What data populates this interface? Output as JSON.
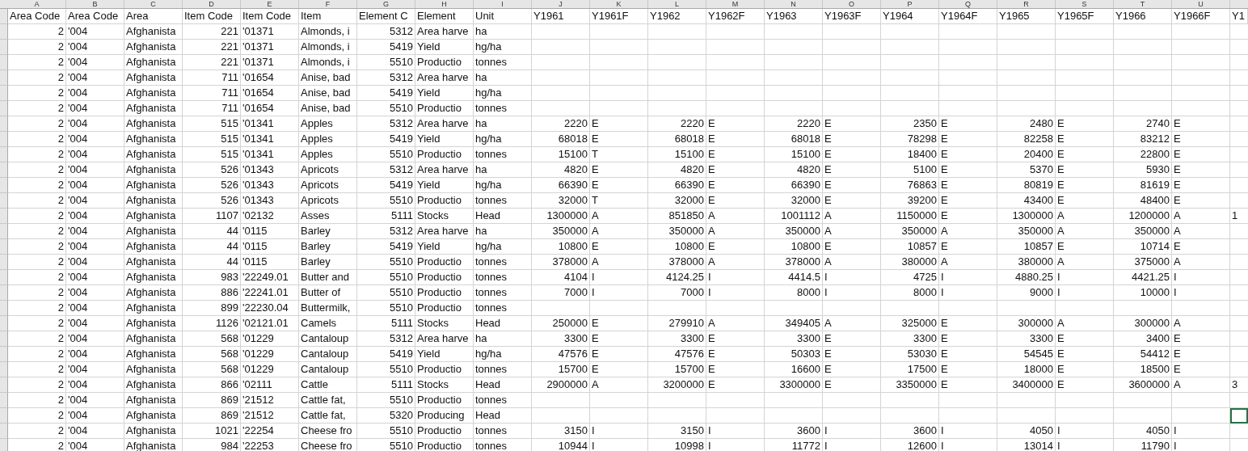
{
  "columns": [
    {
      "letter": "A",
      "heading": "Area Code",
      "kind": "number"
    },
    {
      "letter": "B",
      "heading": "Area Code",
      "kind": "text"
    },
    {
      "letter": "C",
      "heading": "Area",
      "kind": "text"
    },
    {
      "letter": "D",
      "heading": "Item Code",
      "kind": "number"
    },
    {
      "letter": "E",
      "heading": "Item Code",
      "kind": "text"
    },
    {
      "letter": "F",
      "heading": "Item",
      "kind": "text"
    },
    {
      "letter": "G",
      "heading": "Element C",
      "kind": "number"
    },
    {
      "letter": "H",
      "heading": "Element",
      "kind": "text"
    },
    {
      "letter": "I",
      "heading": "Unit",
      "kind": "text"
    },
    {
      "letter": "J",
      "heading": "Y1961",
      "kind": "number"
    },
    {
      "letter": "K",
      "heading": "Y1961F",
      "kind": "text"
    },
    {
      "letter": "L",
      "heading": "Y1962",
      "kind": "number"
    },
    {
      "letter": "M",
      "heading": "Y1962F",
      "kind": "text"
    },
    {
      "letter": "N",
      "heading": "Y1963",
      "kind": "number"
    },
    {
      "letter": "O",
      "heading": "Y1963F",
      "kind": "text"
    },
    {
      "letter": "P",
      "heading": "Y1964",
      "kind": "number"
    },
    {
      "letter": "Q",
      "heading": "Y1964F",
      "kind": "text"
    },
    {
      "letter": "R",
      "heading": "Y1965",
      "kind": "number"
    },
    {
      "letter": "S",
      "heading": "Y1965F",
      "kind": "text"
    },
    {
      "letter": "T",
      "heading": "Y1966",
      "kind": "number"
    },
    {
      "letter": "U",
      "heading": "Y1966F",
      "kind": "text"
    }
  ],
  "column_v_heading": "Y1",
  "rows": [
    {
      "selected": false,
      "cells": [
        "2",
        "'004",
        "Afghanista",
        "221",
        "'01371",
        "Almonds, i",
        "5312",
        "Area harve",
        "ha",
        null,
        null,
        null,
        null,
        null,
        null,
        null,
        null,
        null,
        null,
        null,
        null
      ]
    },
    {
      "selected": false,
      "cells": [
        "2",
        "'004",
        "Afghanista",
        "221",
        "'01371",
        "Almonds, i",
        "5419",
        "Yield",
        "hg/ha",
        null,
        null,
        null,
        null,
        null,
        null,
        null,
        null,
        null,
        null,
        null,
        null
      ]
    },
    {
      "selected": false,
      "cells": [
        "2",
        "'004",
        "Afghanista",
        "221",
        "'01371",
        "Almonds, i",
        "5510",
        "Productio",
        "tonnes",
        null,
        null,
        null,
        null,
        null,
        null,
        null,
        null,
        null,
        null,
        null,
        null
      ]
    },
    {
      "selected": false,
      "cells": [
        "2",
        "'004",
        "Afghanista",
        "711",
        "'01654",
        "Anise, bad",
        "5312",
        "Area harve",
        "ha",
        null,
        null,
        null,
        null,
        null,
        null,
        null,
        null,
        null,
        null,
        null,
        null
      ]
    },
    {
      "selected": false,
      "cells": [
        "2",
        "'004",
        "Afghanista",
        "711",
        "'01654",
        "Anise, bad",
        "5419",
        "Yield",
        "hg/ha",
        null,
        null,
        null,
        null,
        null,
        null,
        null,
        null,
        null,
        null,
        null,
        null
      ]
    },
    {
      "selected": false,
      "cells": [
        "2",
        "'004",
        "Afghanista",
        "711",
        "'01654",
        "Anise, bad",
        "5510",
        "Productio",
        "tonnes",
        null,
        null,
        null,
        null,
        null,
        null,
        null,
        null,
        null,
        null,
        null,
        null
      ]
    },
    {
      "selected": false,
      "cells": [
        "2",
        "'004",
        "Afghanista",
        "515",
        "'01341",
        "Apples",
        "5312",
        "Area harve",
        "ha",
        "2220",
        "E",
        "2220",
        "E",
        "2220",
        "E",
        "2350",
        "E",
        "2480",
        "E",
        "2740",
        "E"
      ]
    },
    {
      "selected": false,
      "cells": [
        "2",
        "'004",
        "Afghanista",
        "515",
        "'01341",
        "Apples",
        "5419",
        "Yield",
        "hg/ha",
        "68018",
        "E",
        "68018",
        "E",
        "68018",
        "E",
        "78298",
        "E",
        "82258",
        "E",
        "83212",
        "E"
      ]
    },
    {
      "selected": false,
      "cells": [
        "2",
        "'004",
        "Afghanista",
        "515",
        "'01341",
        "Apples",
        "5510",
        "Productio",
        "tonnes",
        "15100",
        "T",
        "15100",
        "E",
        "15100",
        "E",
        "18400",
        "E",
        "20400",
        "E",
        "22800",
        "E"
      ]
    },
    {
      "selected": false,
      "cells": [
        "2",
        "'004",
        "Afghanista",
        "526",
        "'01343",
        "Apricots",
        "5312",
        "Area harve",
        "ha",
        "4820",
        "E",
        "4820",
        "E",
        "4820",
        "E",
        "5100",
        "E",
        "5370",
        "E",
        "5930",
        "E"
      ]
    },
    {
      "selected": false,
      "cells": [
        "2",
        "'004",
        "Afghanista",
        "526",
        "'01343",
        "Apricots",
        "5419",
        "Yield",
        "hg/ha",
        "66390",
        "E",
        "66390",
        "E",
        "66390",
        "E",
        "76863",
        "E",
        "80819",
        "E",
        "81619",
        "E"
      ]
    },
    {
      "selected": false,
      "cells": [
        "2",
        "'004",
        "Afghanista",
        "526",
        "'01343",
        "Apricots",
        "5510",
        "Productio",
        "tonnes",
        "32000",
        "T",
        "32000",
        "E",
        "32000",
        "E",
        "39200",
        "E",
        "43400",
        "E",
        "48400",
        "E"
      ]
    },
    {
      "selected": false,
      "column_v": "1",
      "cells": [
        "2",
        "'004",
        "Afghanista",
        "1107",
        "'02132",
        "Asses",
        "5111",
        "Stocks",
        "Head",
        "1300000",
        "A",
        "851850",
        "A",
        "1001112",
        "A",
        "1150000",
        "E",
        "1300000",
        "A",
        "1200000",
        "A"
      ]
    },
    {
      "selected": false,
      "cells": [
        "2",
        "'004",
        "Afghanista",
        "44",
        "'0115",
        "Barley",
        "5312",
        "Area harve",
        "ha",
        "350000",
        "A",
        "350000",
        "A",
        "350000",
        "A",
        "350000",
        "A",
        "350000",
        "A",
        "350000",
        "A"
      ]
    },
    {
      "selected": false,
      "cells": [
        "2",
        "'004",
        "Afghanista",
        "44",
        "'0115",
        "Barley",
        "5419",
        "Yield",
        "hg/ha",
        "10800",
        "E",
        "10800",
        "E",
        "10800",
        "E",
        "10857",
        "E",
        "10857",
        "E",
        "10714",
        "E"
      ]
    },
    {
      "selected": false,
      "cells": [
        "2",
        "'004",
        "Afghanista",
        "44",
        "'0115",
        "Barley",
        "5510",
        "Productio",
        "tonnes",
        "378000",
        "A",
        "378000",
        "A",
        "378000",
        "A",
        "380000",
        "A",
        "380000",
        "A",
        "375000",
        "A"
      ]
    },
    {
      "selected": false,
      "cells": [
        "2",
        "'004",
        "Afghanista",
        "983",
        "'22249.01",
        "Butter and",
        "5510",
        "Productio",
        "tonnes",
        "4104",
        "I",
        "4124.25",
        "I",
        "4414.5",
        "I",
        "4725",
        "I",
        "4880.25",
        "I",
        "4421.25",
        "I"
      ]
    },
    {
      "selected": false,
      "cells": [
        "2",
        "'004",
        "Afghanista",
        "886",
        "'22241.01",
        "Butter of",
        "5510",
        "Productio",
        "tonnes",
        "7000",
        "I",
        "7000",
        "I",
        "8000",
        "I",
        "8000",
        "I",
        "9000",
        "I",
        "10000",
        "I"
      ]
    },
    {
      "selected": false,
      "cells": [
        "2",
        "'004",
        "Afghanista",
        "899",
        "'22230.04",
        "Buttermilk,",
        "5510",
        "Productio",
        "tonnes",
        null,
        null,
        null,
        null,
        null,
        null,
        null,
        null,
        null,
        null,
        null,
        null
      ]
    },
    {
      "selected": false,
      "cells": [
        "2",
        "'004",
        "Afghanista",
        "1126",
        "'02121.01",
        "Camels",
        "5111",
        "Stocks",
        "Head",
        "250000",
        "E",
        "279910",
        "A",
        "349405",
        "A",
        "325000",
        "E",
        "300000",
        "A",
        "300000",
        "A"
      ]
    },
    {
      "selected": false,
      "cells": [
        "2",
        "'004",
        "Afghanista",
        "568",
        "'01229",
        "Cantaloup",
        "5312",
        "Area harve",
        "ha",
        "3300",
        "E",
        "3300",
        "E",
        "3300",
        "E",
        "3300",
        "E",
        "3300",
        "E",
        "3400",
        "E"
      ]
    },
    {
      "selected": false,
      "cells": [
        "2",
        "'004",
        "Afghanista",
        "568",
        "'01229",
        "Cantaloup",
        "5419",
        "Yield",
        "hg/ha",
        "47576",
        "E",
        "47576",
        "E",
        "50303",
        "E",
        "53030",
        "E",
        "54545",
        "E",
        "54412",
        "E"
      ]
    },
    {
      "selected": false,
      "cells": [
        "2",
        "'004",
        "Afghanista",
        "568",
        "'01229",
        "Cantaloup",
        "5510",
        "Productio",
        "tonnes",
        "15700",
        "E",
        "15700",
        "E",
        "16600",
        "E",
        "17500",
        "E",
        "18000",
        "E",
        "18500",
        "E"
      ]
    },
    {
      "selected": false,
      "column_v": "3",
      "cells": [
        "2",
        "'004",
        "Afghanista",
        "866",
        "'02111",
        "Cattle",
        "5111",
        "Stocks",
        "Head",
        "2900000",
        "A",
        "3200000",
        "E",
        "3300000",
        "E",
        "3350000",
        "E",
        "3400000",
        "E",
        "3600000",
        "A"
      ]
    },
    {
      "selected": false,
      "cells": [
        "2",
        "'004",
        "Afghanista",
        "869",
        "'21512",
        "Cattle fat,",
        "5510",
        "Productio",
        "tonnes",
        null,
        null,
        null,
        null,
        null,
        null,
        null,
        null,
        null,
        null,
        null,
        null
      ]
    },
    {
      "selected": true,
      "cells": [
        "2",
        "'004",
        "Afghanista",
        "869",
        "'21512",
        "Cattle fat,",
        "5320",
        "Producing",
        "Head",
        null,
        null,
        null,
        null,
        null,
        null,
        null,
        null,
        null,
        null,
        null,
        null
      ]
    },
    {
      "selected": false,
      "cells": [
        "2",
        "'004",
        "Afghanista",
        "1021",
        "'22254",
        "Cheese fro",
        "5510",
        "Productio",
        "tonnes",
        "3150",
        "I",
        "3150",
        "I",
        "3600",
        "I",
        "3600",
        "I",
        "4050",
        "I",
        "4050",
        "I"
      ]
    },
    {
      "selected": false,
      "cells": [
        "2",
        "'004",
        "Afghanista",
        "984",
        "'22253",
        "Cheese fro",
        "5510",
        "Productio",
        "tonnes",
        "10944",
        "I",
        "10998",
        "I",
        "11772",
        "I",
        "12600",
        "I",
        "13014",
        "I",
        "11790",
        "I"
      ]
    }
  ]
}
